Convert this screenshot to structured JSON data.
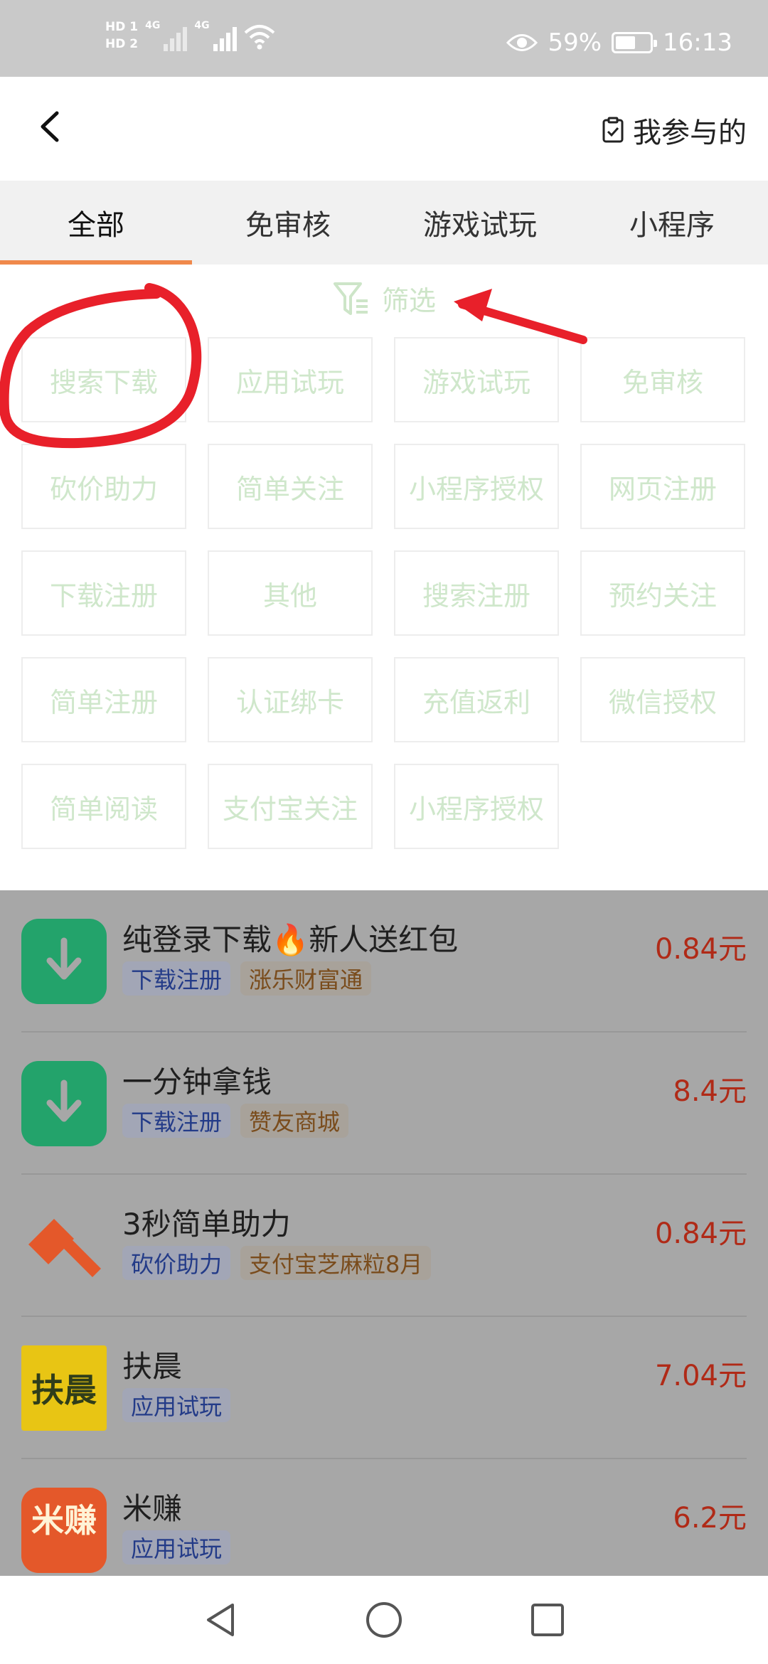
{
  "status_bar": {
    "hd1": "HD 1",
    "hd2": "HD 2",
    "network1": "4G",
    "network2": "4G",
    "battery_percent": "59%",
    "battery_level": 0.59,
    "time": "16:13"
  },
  "header": {
    "my_participation": "我参与的"
  },
  "tabs": [
    {
      "label": "全部",
      "active": true
    },
    {
      "label": "免审核",
      "active": false
    },
    {
      "label": "游戏试玩",
      "active": false
    },
    {
      "label": "小程序",
      "active": false
    }
  ],
  "filter": {
    "title": "筛选",
    "chips": [
      "搜索下载",
      "应用试玩",
      "游戏试玩",
      "免审核",
      "砍价助力",
      "简单关注",
      "小程序授权",
      "网页注册",
      "下载注册",
      "其他",
      "搜索注册",
      "预约关注",
      "简单注册",
      "认证绑卡",
      "充值返利",
      "微信授权",
      "简单阅读",
      "支付宝关注",
      "小程序授权"
    ]
  },
  "list": [
    {
      "title": "纯登录下载🔥新人送红包",
      "tags": [
        "下载注册",
        "涨乐财富通"
      ],
      "price": "0.84元",
      "icon": "download-icon"
    },
    {
      "title": "一分钟拿钱",
      "tags": [
        "下载注册",
        "赞友商城"
      ],
      "price": "8.4元",
      "icon": "download-icon"
    },
    {
      "title": "3秒简单助力",
      "tags": [
        "砍价助力",
        "支付宝芝麻粒8月"
      ],
      "price": "0.84元",
      "icon": "axe-icon"
    },
    {
      "title": "扶晨",
      "tags": [
        "应用试玩"
      ],
      "price": "7.04元",
      "icon_text": "扶晨"
    },
    {
      "title": "米赚",
      "tags": [
        "应用试玩"
      ],
      "price": "6.2元",
      "icon_text": "米赚"
    }
  ],
  "colors": {
    "accent": "#f0894b",
    "chip_text": "#cfe7cb",
    "price": "#b02a17",
    "annotation": "#e8202a"
  }
}
